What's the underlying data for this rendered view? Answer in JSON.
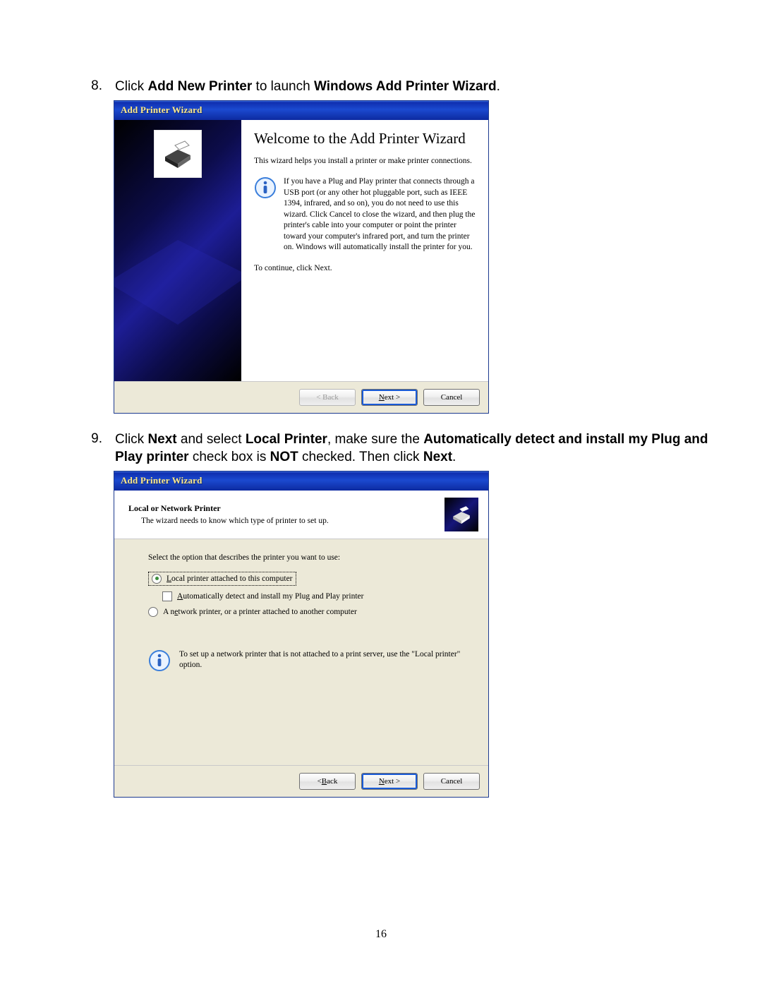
{
  "page_number": "16",
  "steps": [
    {
      "num": "8.",
      "parts": [
        {
          "t": "Click ",
          "b": false
        },
        {
          "t": "Add New Printer",
          "b": true
        },
        {
          "t": " to launch ",
          "b": false
        },
        {
          "t": "Windows Add Printer Wizard",
          "b": true
        },
        {
          "t": ".",
          "b": false
        }
      ]
    },
    {
      "num": "9.",
      "parts": [
        {
          "t": "Click ",
          "b": false
        },
        {
          "t": "Next",
          "b": true
        },
        {
          "t": " and select ",
          "b": false
        },
        {
          "t": "Local Printer",
          "b": true
        },
        {
          "t": ", make sure the ",
          "b": false
        },
        {
          "t": "Automatically detect and install my Plug and Play printer",
          "b": true
        },
        {
          "t": " check box is ",
          "b": false
        },
        {
          "t": "NOT",
          "b": true
        },
        {
          "t": " checked. Then click ",
          "b": false
        },
        {
          "t": "Next",
          "b": true
        },
        {
          "t": ".",
          "b": false
        }
      ]
    }
  ],
  "dlg1": {
    "title": "Add Printer Wizard",
    "heading": "Welcome to the Add Printer Wizard",
    "desc": "This wizard helps you install a printer or make printer connections.",
    "info": "If you have a Plug and Play printer that connects through a USB port (or any other hot pluggable port, such as IEEE 1394, infrared, and so on), you do not need to use this wizard. Click Cancel to close the wizard, and then plug the printer's cable into your computer or point the printer toward your computer's infrared port, and turn the printer on. Windows will automatically install the printer for you.",
    "cont": "To continue, click Next.",
    "back": "< Back",
    "next_pre": "N",
    "next_rest": "ext >",
    "cancel": "Cancel"
  },
  "dlg2": {
    "title": "Add Printer Wizard",
    "hdr1": "Local or Network Printer",
    "hdr2": "The wizard needs to know which type of printer to set up.",
    "select_label": "Select the option that describes the printer you want to use:",
    "opt1_pre": "L",
    "opt1_rest": "ocal printer attached to this computer",
    "opt1a_pre": "A",
    "opt1a_rest": "utomatically detect and install my Plug and Play printer",
    "opt2_pre": "A n",
    "opt2_u": "e",
    "opt2_rest": "twork printer, or a printer attached to another computer",
    "info": "To set up a network printer that is not attached to a print server, use the \"Local printer\" option.",
    "back_pre": "< ",
    "back_u": "B",
    "back_rest": "ack",
    "next_pre": "N",
    "next_rest": "ext >",
    "cancel": "Cancel"
  }
}
